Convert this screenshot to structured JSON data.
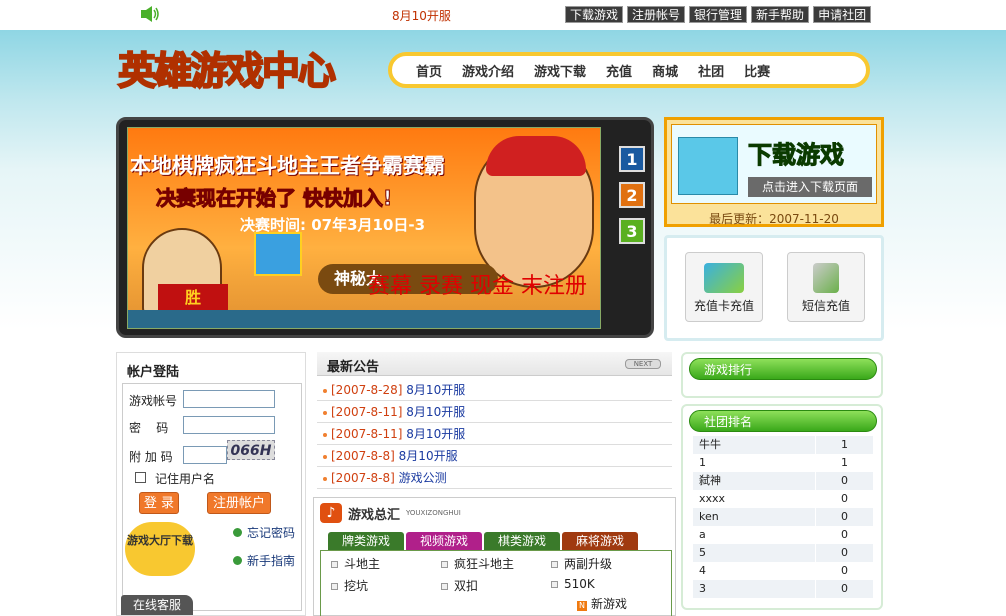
{
  "topbar": {
    "notice": "8月10开服",
    "links": [
      "下载游戏",
      "注册帐号",
      "银行管理",
      "新手帮助",
      "申请社团"
    ]
  },
  "logo": {
    "text": "英雄游戏中心"
  },
  "nav": [
    "首页",
    "游戏介绍",
    "游戏下载",
    "充值",
    "商城",
    "社团",
    "比赛"
  ],
  "banner": {
    "line1": "本地棋牌疯狂斗地主王者争霸赛霸",
    "line2": "决赛现在开始了 快快加入!",
    "line3": "决赛时间: 07年3月10日-3",
    "strip": "神秘大",
    "red_overlay": "赛幕 录赛 现金 末注册",
    "sign": "胜",
    "numbers": [
      "1",
      "2",
      "3"
    ]
  },
  "download": {
    "title": "下载游戏",
    "button": "点击进入下载页面",
    "updated": "最后更新：2007-11-20"
  },
  "recharge": {
    "items": [
      "充值卡充值",
      "短信充值"
    ]
  },
  "login": {
    "title": "帐户登陆",
    "account_label": "游戏帐号",
    "password_label": "密    码",
    "captcha_label": "附 加 码",
    "captcha_code": "066H",
    "remember": "记住用户名",
    "login_btn": "登 录",
    "register_btn": "注册帐户",
    "hall": "游戏大厅下载",
    "forgot": "忘记密码",
    "guide": "新手指南",
    "service": "在线客服"
  },
  "notices": {
    "title": "最新公告",
    "next": "NEXT",
    "items": [
      {
        "date": "[2007-8-28]",
        "title": "8月10开服"
      },
      {
        "date": "[2007-8-11]",
        "title": "8月10开服"
      },
      {
        "date": "[2007-8-11]",
        "title": "8月10开服"
      },
      {
        "date": "[2007-8-8]",
        "title": "8月10开服"
      },
      {
        "date": "[2007-8-8]",
        "title": "游戏公测"
      }
    ]
  },
  "games": {
    "title": "游戏总汇",
    "subtitle": "YOUXIZONGHUI",
    "tabs": [
      {
        "label": "牌类游戏",
        "color": "#3a7a2a"
      },
      {
        "label": "视频游戏",
        "color": "#b0208a"
      },
      {
        "label": "棋类游戏",
        "color": "#3a7a2a"
      },
      {
        "label": "麻将游戏",
        "color": "#a03a10"
      }
    ],
    "items": [
      "斗地主",
      "疯狂斗地主",
      "两副升级",
      "挖坑",
      "双扣",
      "510K"
    ],
    "new_game": "新游戏"
  },
  "game_rank": {
    "title": "游戏排行"
  },
  "club_rank": {
    "title": "社团排名",
    "rows": [
      {
        "name": "牛牛",
        "value": "1"
      },
      {
        "name": "1",
        "value": "1"
      },
      {
        "name": "弑神",
        "value": "0"
      },
      {
        "name": "xxxx",
        "value": "0"
      },
      {
        "name": "ken",
        "value": "0"
      },
      {
        "name": "a",
        "value": "0"
      },
      {
        "name": "5",
        "value": "0"
      },
      {
        "name": "4",
        "value": "0"
      },
      {
        "name": "3",
        "value": "0"
      }
    ]
  }
}
